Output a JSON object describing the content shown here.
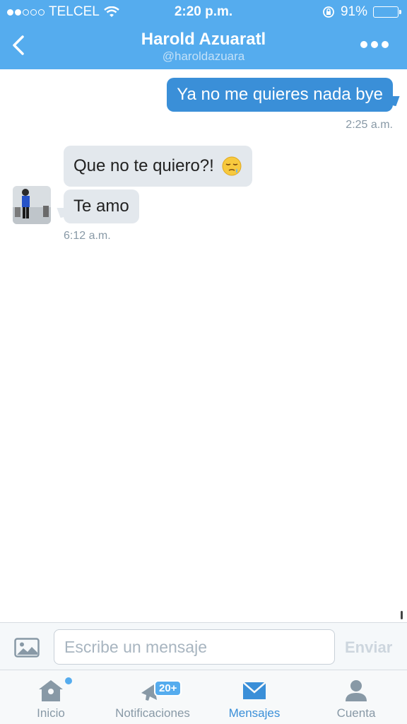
{
  "status_bar": {
    "carrier": "TELCEL",
    "time": "2:20 p.m.",
    "battery": "91%",
    "battery_level": 0.91
  },
  "header": {
    "name": "Harold Azuaratl",
    "handle": "@haroldazuara"
  },
  "messages": {
    "sent": {
      "text": "Ya no me quieres nada bye",
      "time": "2:25 a.m."
    },
    "received": [
      {
        "text": "Que no te quiero?!",
        "emoji": "pensive-face-icon"
      },
      {
        "text": "Te amo"
      }
    ],
    "received_time": "6:12 a.m."
  },
  "composer": {
    "placeholder": "Escribe un mensaje",
    "send_label": "Enviar"
  },
  "tabs": [
    {
      "label": "Inicio"
    },
    {
      "label": "Notificaciones",
      "badge": "20+"
    },
    {
      "label": "Mensajes",
      "active": true
    },
    {
      "label": "Cuenta"
    }
  ],
  "colors": {
    "brand": "#55acee",
    "sent_bubble": "#3a8fd8",
    "received_bubble": "#e3e8ed"
  }
}
